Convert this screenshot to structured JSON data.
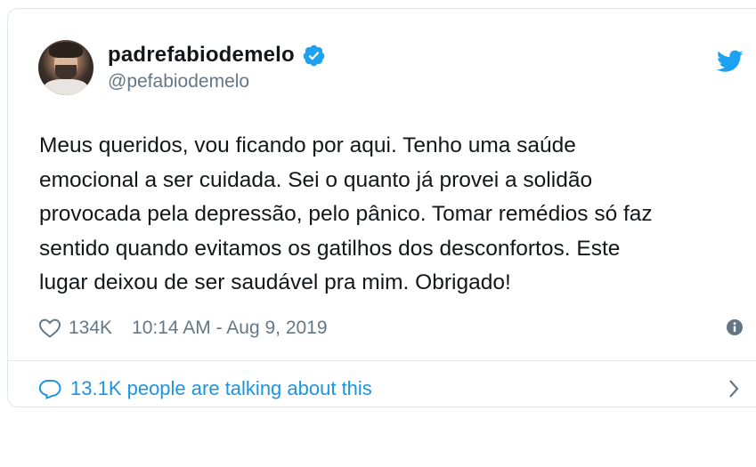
{
  "tweet": {
    "display_name": "padrefabiodemelo",
    "handle": "@pefabiodemelo",
    "text": "Meus queridos, vou ficando por aqui. Tenho uma saúde\nemocional a ser cuidada. Sei o quanto já provei a solidão\nprovocada pela depressão, pelo pânico. Tomar remédios só faz\nsentido quando evitamos os gatilhos dos desconfortos. Este\nlugar deixou de ser saudável pra mim. Obrigado!",
    "likes": "134K",
    "timestamp": "10:14 AM - Aug 9, 2019",
    "talking": "13.1K people are talking about this"
  },
  "icons": {
    "verified": "verified-badge-icon",
    "brand": "twitter-bird-icon",
    "like": "heart-icon",
    "info": "info-icon",
    "reply": "speech-bubble-icon",
    "chevron": "chevron-right-icon"
  },
  "colors": {
    "brand_blue": "#1da1f2",
    "link_blue": "#1b95e0",
    "text": "#14171a",
    "muted": "#657786",
    "border": "#e1e8ed"
  }
}
